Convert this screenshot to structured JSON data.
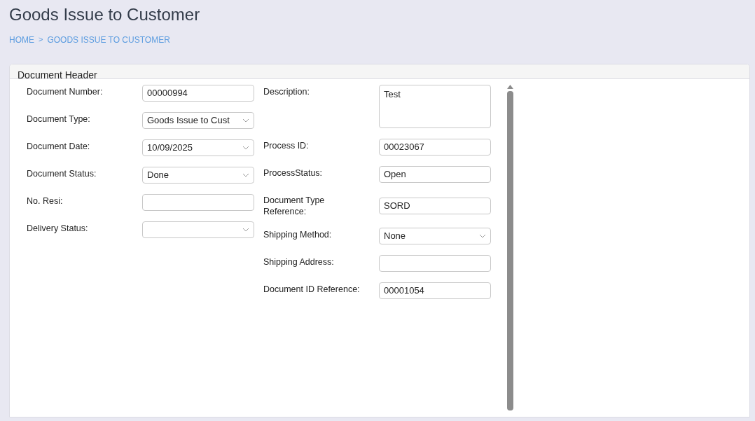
{
  "page": {
    "title": "Goods Issue to Customer",
    "breadcrumb": [
      {
        "label": "HOME"
      },
      {
        "label": "GOODS ISSUE TO CUSTOMER"
      }
    ],
    "breadcrumb_separator": ">"
  },
  "panel": {
    "title": "Document Header",
    "columns": [
      {
        "fields": [
          {
            "label": "Document Number:",
            "kind": "text",
            "value": "00000994"
          },
          {
            "label": "Document Type:",
            "kind": "select",
            "value": "Goods Issue to Cust"
          },
          {
            "label": "Document Date:",
            "kind": "select",
            "value": "10/09/2025"
          },
          {
            "label": "Document Status:",
            "kind": "select",
            "value": "Done"
          },
          {
            "label": "No. Resi:",
            "kind": "text"
          },
          {
            "label": "Delivery Status:",
            "kind": "select"
          }
        ]
      },
      {
        "fields": [
          {
            "label": "Description:",
            "kind": "textarea",
            "value": "Test"
          },
          {
            "label": "Process ID:",
            "kind": "text",
            "value": "00023067"
          },
          {
            "label": "ProcessStatus:",
            "kind": "text",
            "value": "Open"
          },
          {
            "label": "Document Type Reference:",
            "kind": "text",
            "value": "SORD"
          },
          {
            "label": "Shipping Method:",
            "kind": "select",
            "value": "None"
          },
          {
            "label": "Shipping Address:",
            "kind": "text"
          },
          {
            "label": "Document ID Reference:",
            "kind": "text",
            "value": "00001054"
          }
        ]
      }
    ]
  }
}
